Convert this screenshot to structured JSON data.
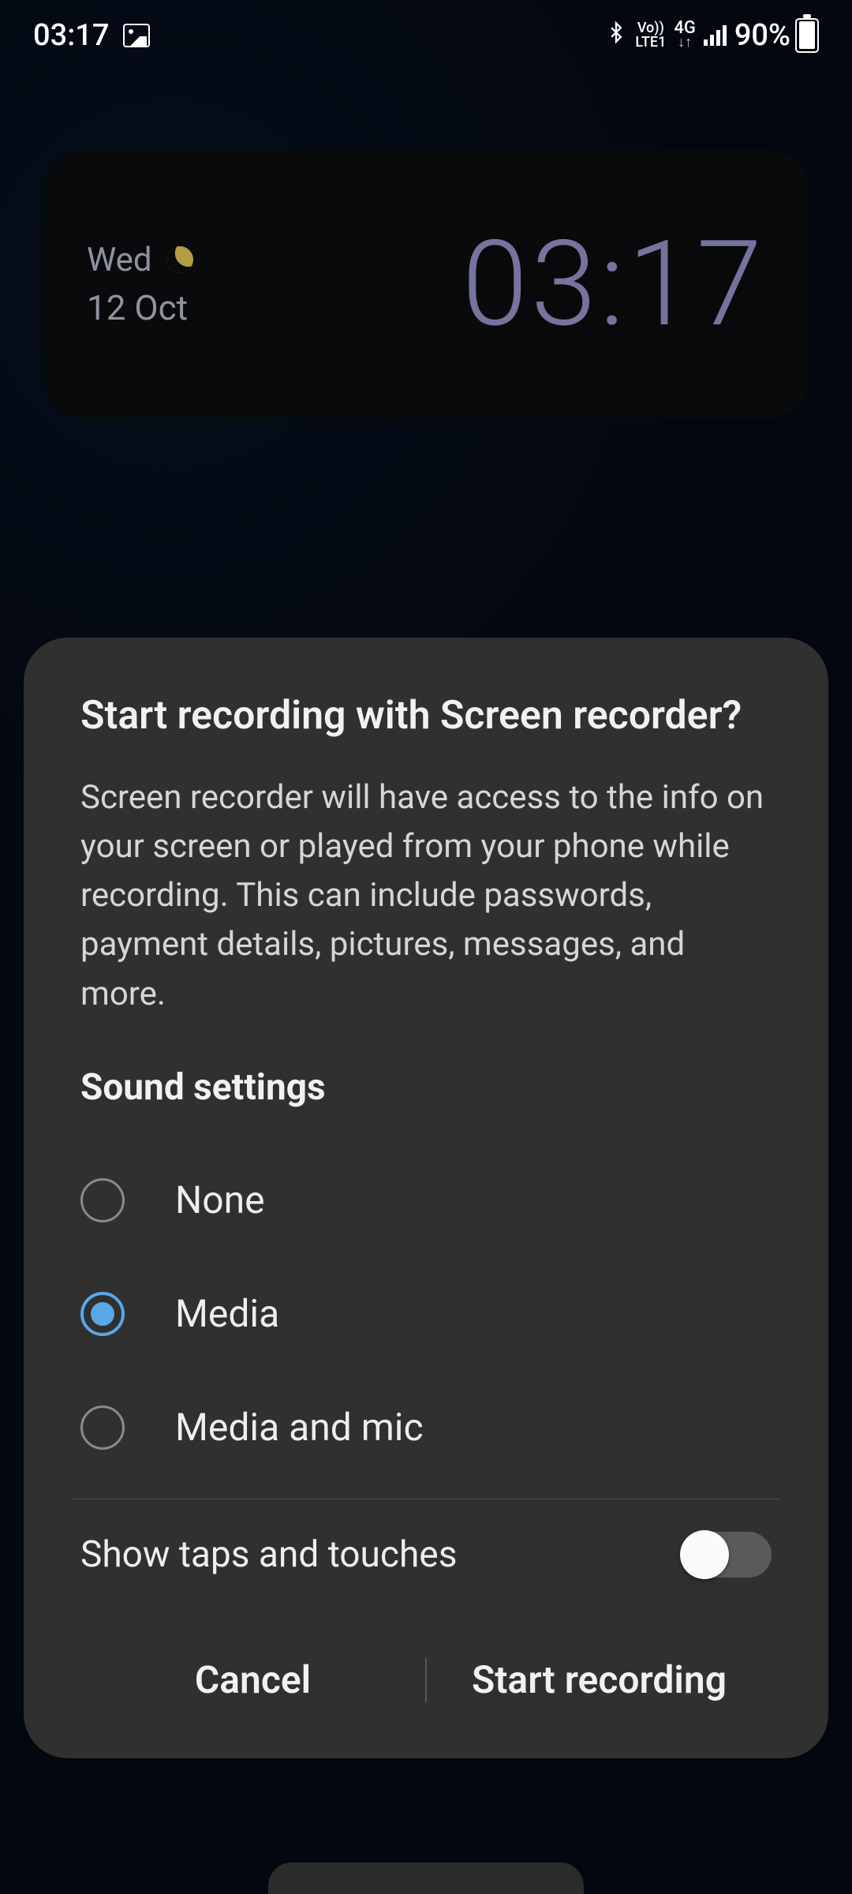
{
  "status": {
    "time": "03:17",
    "battery_pct": "90%",
    "network_label_top": "Vo))",
    "network_label_bottom": "LTE1",
    "data_label": "4G"
  },
  "clock_widget": {
    "day": "Wed",
    "date": "12 Oct",
    "time": "03:17"
  },
  "modal": {
    "title": "Start recording with Screen recorder?",
    "description": "Screen recorder will have access to the info on your screen or played from your phone while recording. This can include passwords, payment details, pictures, messages, and more.",
    "sound_heading": "Sound settings",
    "options": [
      {
        "label": "None",
        "checked": false
      },
      {
        "label": "Media",
        "checked": true
      },
      {
        "label": "Media and mic",
        "checked": false
      }
    ],
    "toggle_label": "Show taps and touches",
    "toggle_on": false,
    "cancel_label": "Cancel",
    "confirm_label": "Start recording"
  }
}
